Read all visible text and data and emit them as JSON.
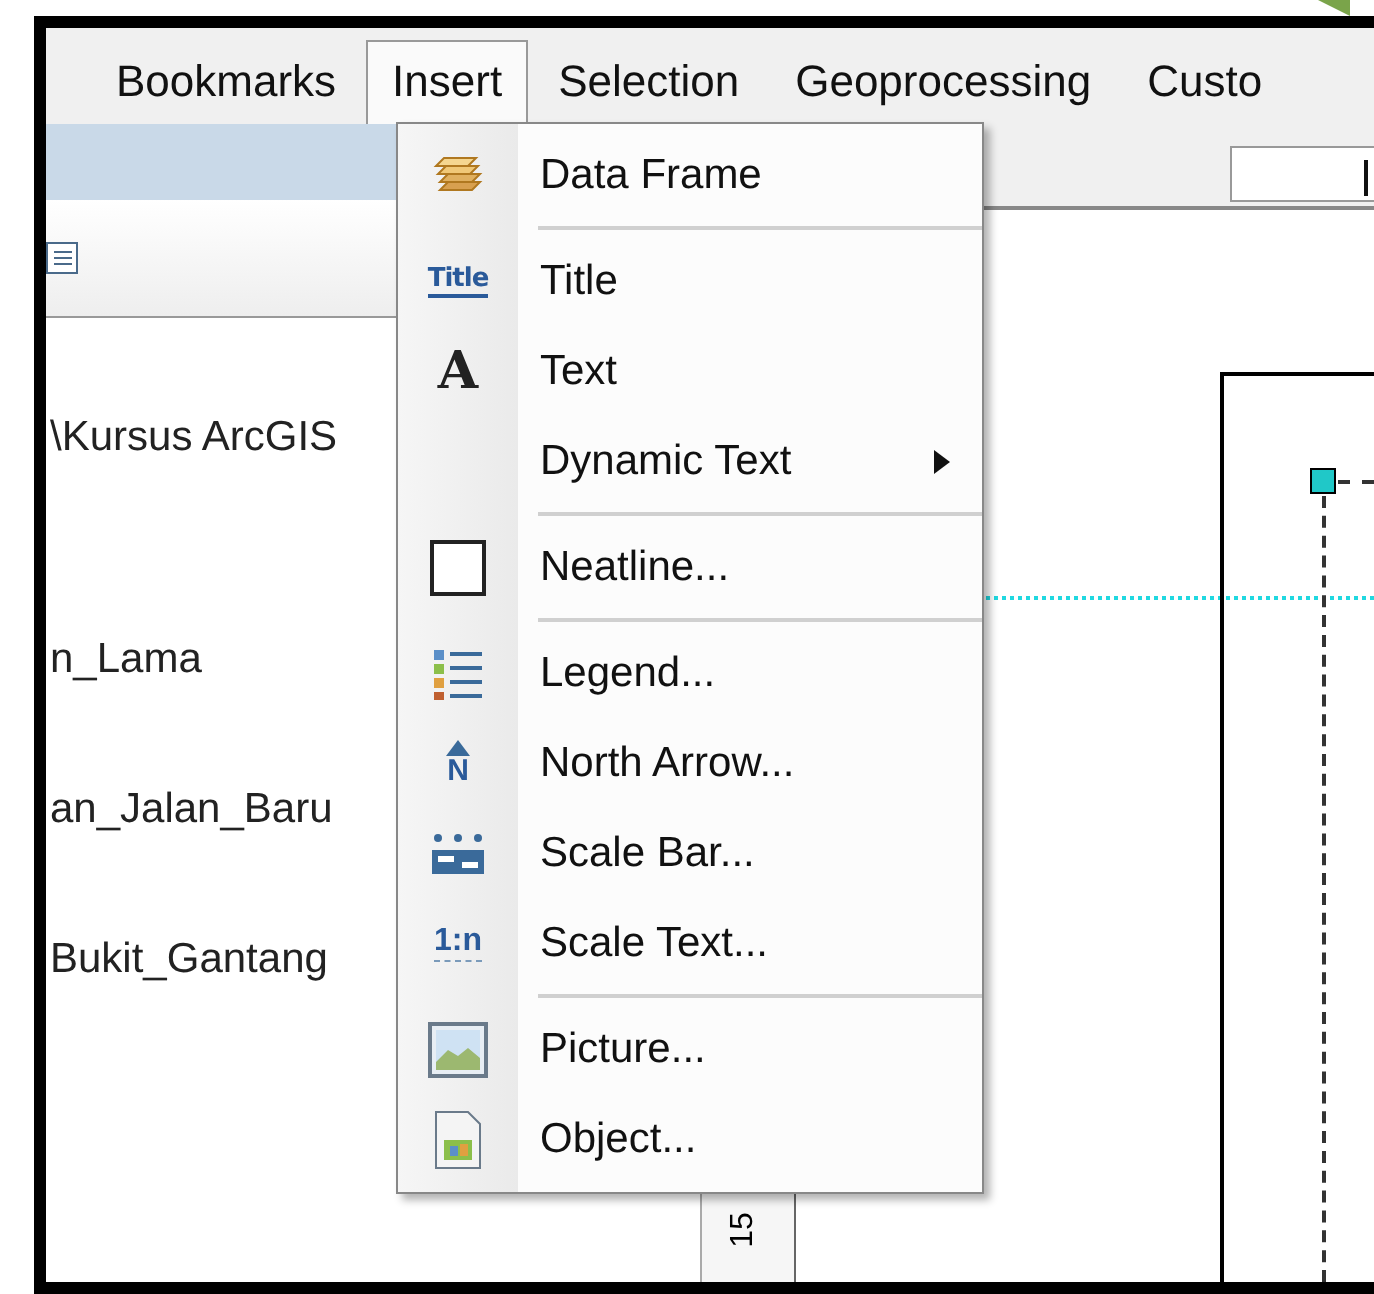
{
  "menubar": {
    "items": [
      {
        "label": "Bookmarks",
        "selected": false
      },
      {
        "label": "Insert",
        "selected": true
      },
      {
        "label": "Selection",
        "selected": false
      },
      {
        "label": "Geoprocessing",
        "selected": false
      },
      {
        "label": "Custo",
        "selected": false
      }
    ]
  },
  "insert_menu": {
    "items": [
      {
        "kind": "item",
        "label": "Data Frame",
        "submenu": false
      },
      {
        "kind": "separator"
      },
      {
        "kind": "item",
        "label": "Title",
        "icon_text": "Title",
        "submenu": false
      },
      {
        "kind": "item",
        "label": "Text",
        "icon_text": "A",
        "submenu": false
      },
      {
        "kind": "item",
        "label": "Dynamic Text",
        "submenu": true
      },
      {
        "kind": "separator"
      },
      {
        "kind": "item",
        "label": "Neatline...",
        "submenu": false
      },
      {
        "kind": "separator"
      },
      {
        "kind": "item",
        "label": "Legend...",
        "submenu": false
      },
      {
        "kind": "item",
        "label": "North Arrow...",
        "icon_text": "N",
        "submenu": false
      },
      {
        "kind": "item",
        "label": "Scale Bar...",
        "submenu": false
      },
      {
        "kind": "item",
        "label": "Scale Text...",
        "icon_text": "1:n",
        "submenu": false
      },
      {
        "kind": "separator"
      },
      {
        "kind": "item",
        "label": "Picture...",
        "submenu": false
      },
      {
        "kind": "item",
        "label": "Object...",
        "submenu": false
      }
    ]
  },
  "table_of_contents": {
    "items": [
      "\\Kursus ArcGIS",
      "n_Lama",
      "an_Jalan_Baru",
      "Bukit_Gantang"
    ]
  },
  "vertical_ruler": {
    "label": "15"
  }
}
